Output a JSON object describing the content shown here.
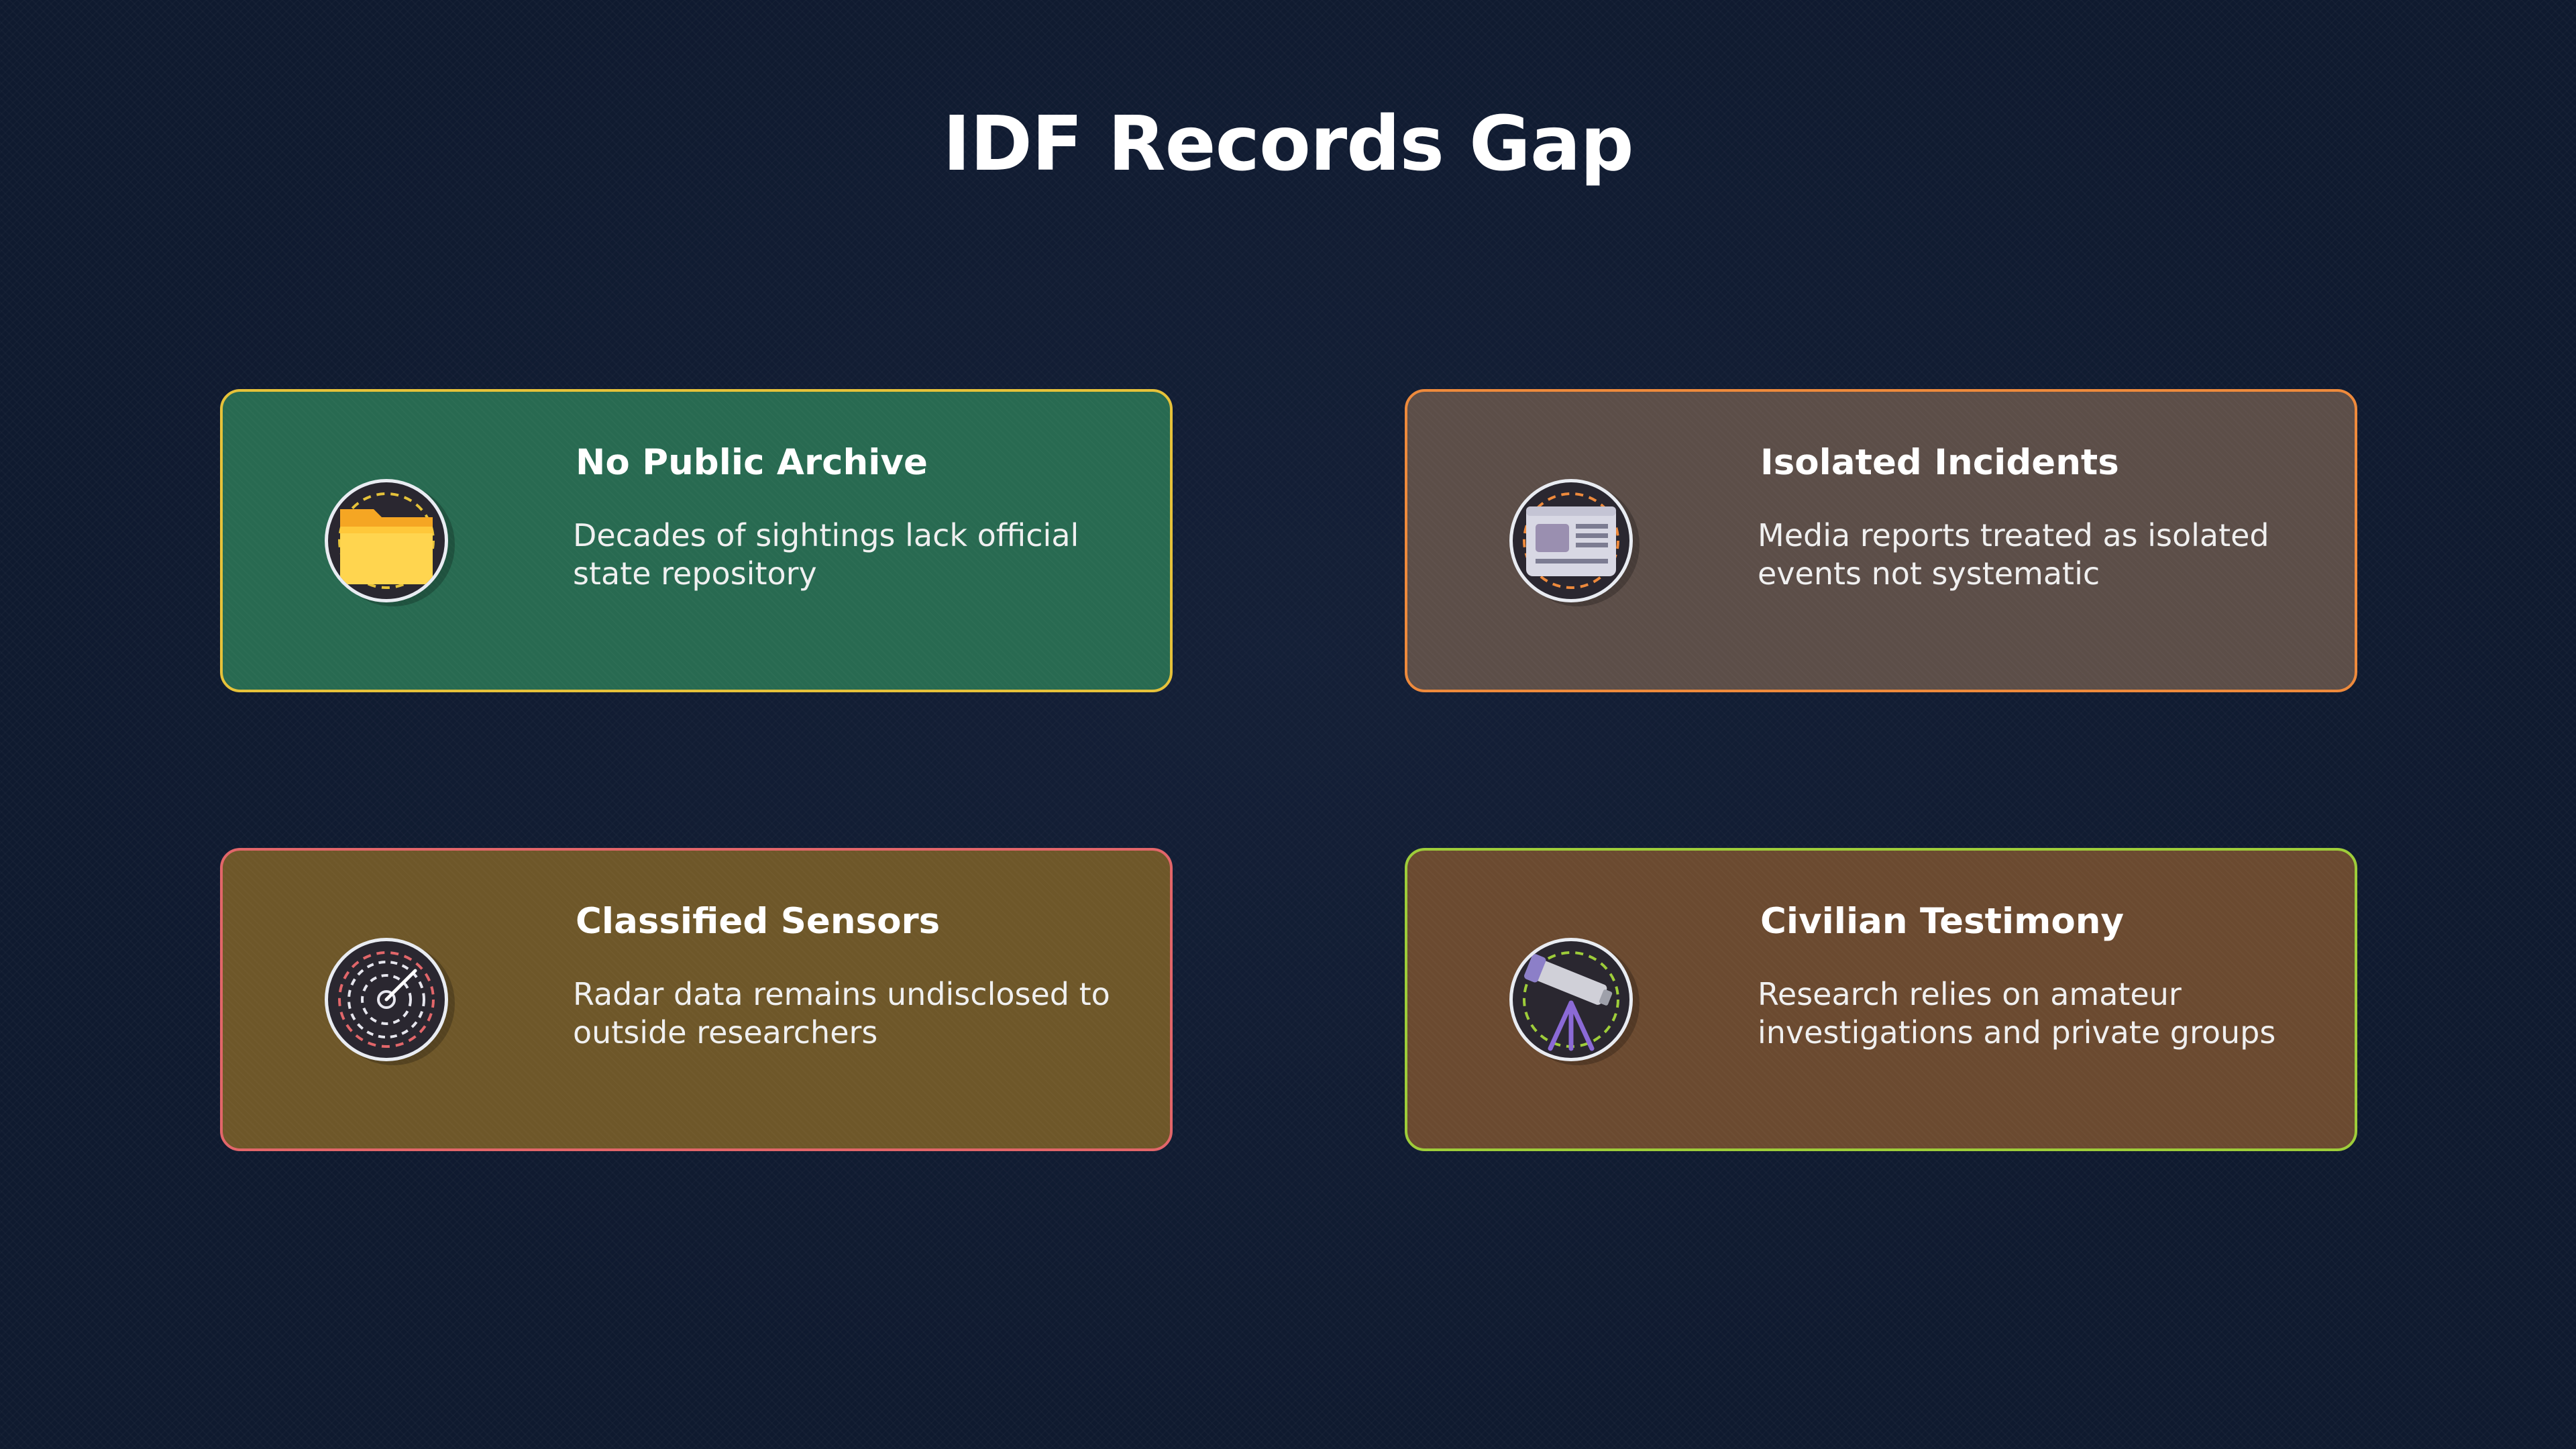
{
  "slide": {
    "title": "IDF Records Gap"
  },
  "cards": [
    {
      "title": "No Public Archive",
      "description": "Decades of sightings lack official state repository",
      "icon": "folder-icon",
      "background_color": "#286a51",
      "border_color": "#e6c23a"
    },
    {
      "title": "Isolated Incidents",
      "description": "Media reports treated as isolated events not systematic",
      "icon": "newspaper-icon",
      "background_color": "#5c4e48",
      "border_color": "#ee8a3c"
    },
    {
      "title": "Classified Sensors",
      "description": "Radar data remains undisclosed to outside researchers",
      "icon": "radar-icon",
      "background_color": "#6e5729",
      "border_color": "#e2666a"
    },
    {
      "title": "Civilian Testimony",
      "description": "Research relies on amateur investigations and private groups",
      "icon": "telescope-icon",
      "background_color": "#6b4a30",
      "border_color": "#9ecd3a"
    }
  ]
}
